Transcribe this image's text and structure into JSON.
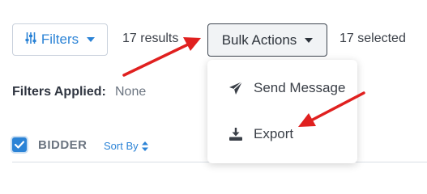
{
  "toolbar": {
    "filters_label": "Filters",
    "results_text": "17 results",
    "bulk_actions_label": "Bulk Actions",
    "selected_text": "17 selected"
  },
  "filters_applied": {
    "label": "Filters Applied:",
    "value": "None"
  },
  "table_header": {
    "checkbox_checked": true,
    "column_label": "BIDDER",
    "sort_label": "Sort By"
  },
  "bulk_menu": {
    "items": [
      {
        "label": "Send Message",
        "icon": "paper-plane-icon"
      },
      {
        "label": "Export",
        "icon": "download-icon"
      }
    ]
  },
  "colors": {
    "accent": "#2b83d6",
    "annotation_arrow": "#e0201f"
  }
}
